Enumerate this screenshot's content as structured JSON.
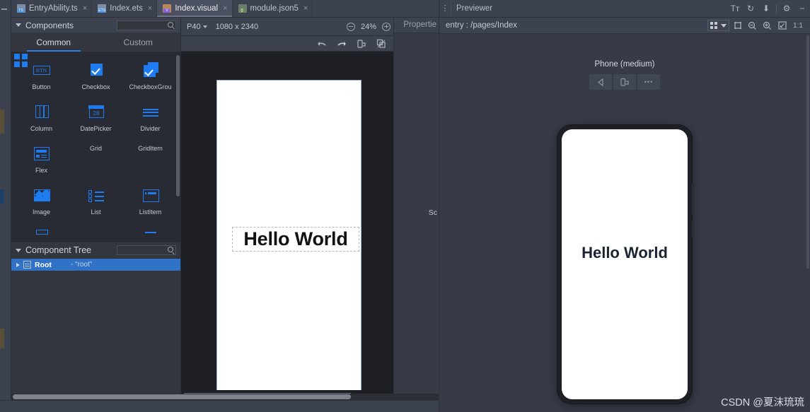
{
  "window": {
    "tabs": [
      {
        "label": "EntryAbility.ts",
        "icon": "ts-file-icon",
        "badge": "TS",
        "badge_color": "#4a90d9",
        "active": false,
        "close": "×"
      },
      {
        "label": "Index.ets",
        "icon": "ets-file-icon",
        "badge": "ETS",
        "badge_color": "#4a90d9",
        "active": false,
        "close": "×"
      },
      {
        "label": "Index.visual",
        "icon": "visual-file-icon",
        "badge": "V",
        "badge_color": "#8a63d2",
        "active": true,
        "close": "×"
      },
      {
        "label": "module.json5",
        "icon": "json-file-icon",
        "badge": "{}",
        "badge_color": "#6a8759",
        "active": false,
        "close": "×"
      }
    ]
  },
  "previewer_titlebar": {
    "menu_icon": "⋮",
    "title": "Previewer",
    "actions": [
      {
        "name": "text-size-icon",
        "glyph": "Tᴛ"
      },
      {
        "name": "refresh-icon",
        "glyph": "↻"
      },
      {
        "name": "download-icon",
        "glyph": "⬇"
      },
      {
        "name": "settings-gear-icon",
        "glyph": "⚙"
      },
      {
        "name": "minimize-icon",
        "glyph": "−"
      }
    ]
  },
  "components_panel": {
    "title": "Components",
    "search_placeholder": "",
    "search_value": "",
    "tabs": [
      {
        "label": "Common",
        "active": true
      },
      {
        "label": "Custom",
        "active": false
      }
    ],
    "items": [
      {
        "label": "Button",
        "icon": "button-icon",
        "glyph": "BTN"
      },
      {
        "label": "Checkbox",
        "icon": "checkbox-icon"
      },
      {
        "label": "CheckboxGrou",
        "icon": "checkbox-group-icon"
      },
      {
        "label": "Column",
        "icon": "column-icon"
      },
      {
        "label": "DatePicker",
        "icon": "datepicker-icon",
        "glyph": "28"
      },
      {
        "label": "Divider",
        "icon": "divider-icon"
      },
      {
        "label": "Flex",
        "icon": "flex-icon"
      },
      {
        "label": "Grid",
        "icon": "grid-icon"
      },
      {
        "label": "GridItem",
        "icon": "griditem-icon"
      },
      {
        "label": "Image",
        "icon": "image-icon"
      },
      {
        "label": "List",
        "icon": "list-icon"
      },
      {
        "label": "ListItem",
        "icon": "listitem-icon"
      }
    ]
  },
  "component_tree": {
    "title": "Component Tree",
    "search_value": "",
    "rows": [
      {
        "name": "Root",
        "value": "- \"root\"",
        "icon": "root-node-icon",
        "selected": true
      }
    ]
  },
  "canvas": {
    "device": "P40",
    "resolution": "1080 x 2340",
    "zoom": "24%",
    "zoom_out_icon": "⊖",
    "zoom_in_icon": "⊕",
    "tools": [
      {
        "name": "undo-icon",
        "glyph": "↶"
      },
      {
        "name": "redo-icon",
        "glyph": "↷"
      },
      {
        "name": "device-rotate-icon",
        "glyph": "▭"
      },
      {
        "name": "layers-icon",
        "glyph": "❐"
      },
      {
        "name": "frame-icon",
        "glyph": "□"
      },
      {
        "name": "align-icon",
        "glyph": "⊞"
      }
    ],
    "artboard_text": "Hello World"
  },
  "properties_panel": {
    "title": "Propertie",
    "truncated_label": "Sc"
  },
  "previewer": {
    "path": "entry : /pages/Index",
    "view_mode_icon": "grid-view-icon",
    "dropdown_icon": "chevron-down-icon",
    "actions": [
      {
        "name": "select-frame-icon",
        "glyph": "⬚"
      },
      {
        "name": "zoom-out-icon",
        "glyph": "⊖"
      },
      {
        "name": "zoom-in-icon",
        "glyph": "⊕"
      },
      {
        "name": "fit-screen-icon",
        "glyph": "⛶"
      },
      {
        "name": "actual-size-label",
        "glyph": "1:1"
      }
    ],
    "device_label": "Phone (medium)",
    "device_controls": [
      {
        "name": "back-button-icon",
        "glyph": "◁"
      },
      {
        "name": "rotate-device-icon",
        "glyph": "▭"
      },
      {
        "name": "more-options-icon",
        "glyph": "•••"
      }
    ],
    "screen_text": "Hello World"
  },
  "watermark": {
    "text": "CSDN @夏沫琉琉"
  },
  "colors": {
    "accent_blue": "#1e7cf0",
    "selection_blue": "#2f72c6",
    "panel_bg": "#33363e",
    "palette_bg": "#282b33",
    "chrome_bg": "#3c4250",
    "preview_bg": "#373b48",
    "canvas_bg": "#1d1f25",
    "device_screen": "#ffffff"
  }
}
